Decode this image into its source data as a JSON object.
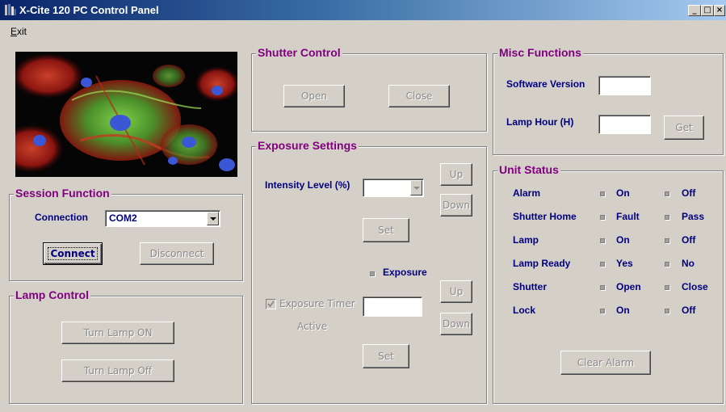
{
  "window": {
    "title": "X-Cite 120 PC Control Panel",
    "minimize": "_",
    "maximize": "□",
    "close": "×"
  },
  "menu": {
    "exit_label": "Exit",
    "exit_mnemonic": "E",
    "exit_rest": "xit"
  },
  "session": {
    "title": "Session Function",
    "connection_label": "Connection",
    "connection_value": "COM2",
    "connect_label": "Connect",
    "disconnect_label": "Disconnect"
  },
  "lamp_control": {
    "title": "Lamp Control",
    "turn_on_label": "Turn Lamp ON",
    "turn_off_label": "Turn Lamp Off"
  },
  "shutter_control": {
    "title": "Shutter Control",
    "open_label": "Open",
    "close_label": "Close"
  },
  "exposure": {
    "title": "Exposure Settings",
    "intensity_label": "Intensity Level (%)",
    "intensity_value": "",
    "up_label": "Up",
    "down_label": "Down",
    "set_label": "Set",
    "exposure_radio_label": "Exposure",
    "timer_checkbox_label": "Exposure Timer",
    "timer_checked": true,
    "active_label": "Active",
    "timer_value": "",
    "up2_label": "Up",
    "down2_label": "Down",
    "set2_label": "Set"
  },
  "misc": {
    "title": "Misc Functions",
    "software_version_label": "Software Version",
    "software_version_value": "",
    "lamp_hour_label": "Lamp Hour (H)",
    "lamp_hour_value": "",
    "get_label": "Get"
  },
  "unit_status": {
    "title": "Unit Status",
    "rows": [
      {
        "name": "Alarm",
        "a": "On",
        "b": "Off"
      },
      {
        "name": "Shutter Home",
        "a": "Fault",
        "b": "Pass"
      },
      {
        "name": "Lamp",
        "a": "On",
        "b": "Off"
      },
      {
        "name": "Lamp Ready",
        "a": "Yes",
        "b": "No"
      },
      {
        "name": "Shutter",
        "a": "Open",
        "b": "Close"
      },
      {
        "name": "Lock",
        "a": "On",
        "b": "Off"
      }
    ],
    "clear_alarm_label": "Clear Alarm"
  },
  "colors": {
    "title_bar_start": "#0a246a",
    "title_bar_end": "#a6caf0",
    "group_title": "#800080",
    "label_text": "#000080",
    "face": "#d4d0c8"
  },
  "image": {
    "icon": "microscopy-cell-image"
  }
}
